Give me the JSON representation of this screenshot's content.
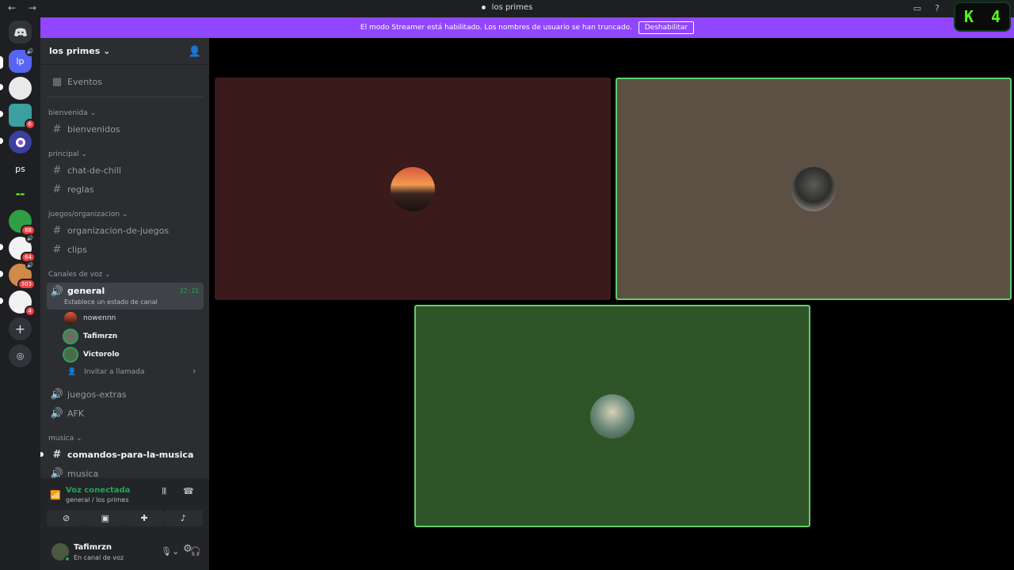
{
  "titlebar": {
    "title": "los primes"
  },
  "kick": {
    "letter": "K",
    "count": "4"
  },
  "banner": {
    "message": "El modo Streamer está habilitado. Los nombres de usuario se han truncado.",
    "button": "Deshabilitar"
  },
  "rail": {
    "servers": [
      {
        "label": "lp"
      },
      {
        "label": ""
      },
      {
        "label": "",
        "badge": "6"
      },
      {
        "label": ""
      },
      {
        "label": "ps"
      },
      {
        "label": ""
      },
      {
        "label": "",
        "badge": "88"
      },
      {
        "label": "",
        "badge": "64"
      },
      {
        "label": "",
        "badge": "303"
      },
      {
        "label": "",
        "badge": "4"
      }
    ]
  },
  "guild": {
    "name": "los primes ⌄"
  },
  "sidebar": {
    "events": "Eventos",
    "categories": {
      "bienvenida": "bienvenida ⌄",
      "principal": "principal ⌄",
      "juegos": "juegos/organizacion ⌄",
      "voz": "Canales de voz ⌄",
      "musica": "musica ⌄"
    },
    "channels": {
      "bienvenidos": "bienvenidos",
      "chat": "chat-de-chill",
      "reglas": "reglas",
      "organizacion": "organizacion-de-juegos",
      "clips": "clips",
      "general": "general",
      "general_status": "Establece un estado de canal",
      "general_time": "22:21",
      "extras": "juegos-extras",
      "afk": "AFK",
      "comandos": "comandos-para-la-musica",
      "musica": "musica"
    },
    "voice_users": [
      "nowennn",
      "Tafimrzn",
      "Victorolo"
    ],
    "invite": "Invitar a llamada"
  },
  "voice_panel": {
    "status": "Voz conectada",
    "location": "general / los primes"
  },
  "user_panel": {
    "name": "Tafimrzn",
    "status": "En canal de voz"
  },
  "colors": {
    "accent": "#9146ff",
    "online": "#23a55a",
    "tile1": "#3a1a1a",
    "tile2": "#5c4f44",
    "tile3": "#2f5428",
    "speaking_border": "#5fcf6b"
  }
}
